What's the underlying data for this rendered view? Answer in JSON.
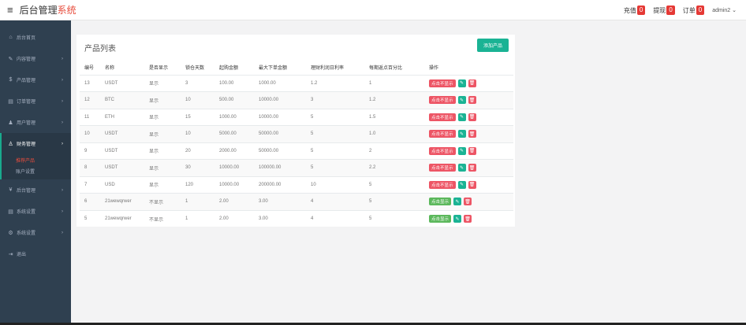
{
  "header": {
    "menu_icon": "hamburger-icon",
    "brand_main": "后台管理",
    "brand_accent": "系统",
    "recharge_label": "充值",
    "recharge_count": "0",
    "withdraw_label": "提现",
    "withdraw_count": "0",
    "order_label": "订单",
    "order_count": "0",
    "user_name": "admin2 ⌄"
  },
  "sidebar": {
    "items": [
      {
        "label": "后台首页",
        "icon": "home-icon",
        "glyph": "⌂"
      },
      {
        "label": "内容管理",
        "icon": "edit-icon",
        "glyph": "✎"
      },
      {
        "label": "产品管理",
        "icon": "dollar-icon",
        "glyph": "$"
      },
      {
        "label": "订单管理",
        "icon": "clipboard-icon",
        "glyph": "▤"
      },
      {
        "label": "用户管理",
        "icon": "user-icon",
        "glyph": "♟"
      },
      {
        "label": "财务管理",
        "icon": "finance-icon",
        "glyph": "♙"
      },
      {
        "label": "后台管理",
        "icon": "yen-icon",
        "glyph": "¥"
      },
      {
        "label": "系统设置",
        "icon": "list-icon",
        "glyph": "▤"
      },
      {
        "label": "系统设置",
        "icon": "cogs-icon",
        "glyph": "⚙"
      },
      {
        "label": "退出",
        "icon": "logout-icon",
        "glyph": "⇥"
      }
    ],
    "sub_items": [
      "推荐产品",
      "账户设置"
    ]
  },
  "panel": {
    "title": "产品列表",
    "add_button": "添加产品"
  },
  "colors": {
    "accent_green": "#1ab394",
    "danger_red": "#ed5565",
    "sidebar_bg": "#2f4050"
  },
  "table": {
    "headers": [
      "编号",
      "名称",
      "是否显示",
      "锁仓天数",
      "起购金额",
      "最大下单金额",
      "理财利润日利率",
      "每期返点百分比",
      "操作"
    ],
    "rows": [
      {
        "id": "13",
        "name": "USDT",
        "show": "显示",
        "days": "3",
        "min": "100.00",
        "max": "1000.00",
        "rate": "1.2",
        "rebate": "1",
        "toggle": "点击不显示",
        "toggle_color": "#ed5565"
      },
      {
        "id": "12",
        "name": "BTC",
        "show": "显示",
        "days": "10",
        "min": "500.00",
        "max": "10000.00",
        "rate": "3",
        "rebate": "1.2",
        "toggle": "点击不显示",
        "toggle_color": "#ed5565"
      },
      {
        "id": "11",
        "name": "ETH",
        "show": "显示",
        "days": "15",
        "min": "1000.00",
        "max": "10000.00",
        "rate": "5",
        "rebate": "1.5",
        "toggle": "点击不显示",
        "toggle_color": "#ed5565"
      },
      {
        "id": "10",
        "name": "USDT",
        "show": "显示",
        "days": "10",
        "min": "5000.00",
        "max": "50000.00",
        "rate": "5",
        "rebate": "1.0",
        "toggle": "点击不显示",
        "toggle_color": "#ed5565"
      },
      {
        "id": "9",
        "name": "USDT",
        "show": "显示",
        "days": "20",
        "min": "2000.00",
        "max": "50000.00",
        "rate": "5",
        "rebate": "2",
        "toggle": "点击不显示",
        "toggle_color": "#ed5565"
      },
      {
        "id": "8",
        "name": "USDT",
        "show": "显示",
        "days": "30",
        "min": "10000.00",
        "max": "100000.00",
        "rate": "5",
        "rebate": "2.2",
        "toggle": "点击不显示",
        "toggle_color": "#ed5565"
      },
      {
        "id": "7",
        "name": "USD",
        "show": "显示",
        "days": "120",
        "min": "10000.00",
        "max": "200000.00",
        "rate": "10",
        "rebate": "5",
        "toggle": "点击不显示",
        "toggle_color": "#ed5565"
      },
      {
        "id": "6",
        "name": "21wewqrwer",
        "show": "不显示",
        "days": "1",
        "min": "2.00",
        "max": "3.00",
        "rate": "4",
        "rebate": "5",
        "toggle": "点击显示",
        "toggle_color": "#5cb85c"
      },
      {
        "id": "5",
        "name": "21wewqrwer",
        "show": "不显示",
        "days": "1",
        "min": "2.00",
        "max": "3.00",
        "rate": "4",
        "rebate": "5",
        "toggle": "点击显示",
        "toggle_color": "#5cb85c"
      }
    ]
  }
}
